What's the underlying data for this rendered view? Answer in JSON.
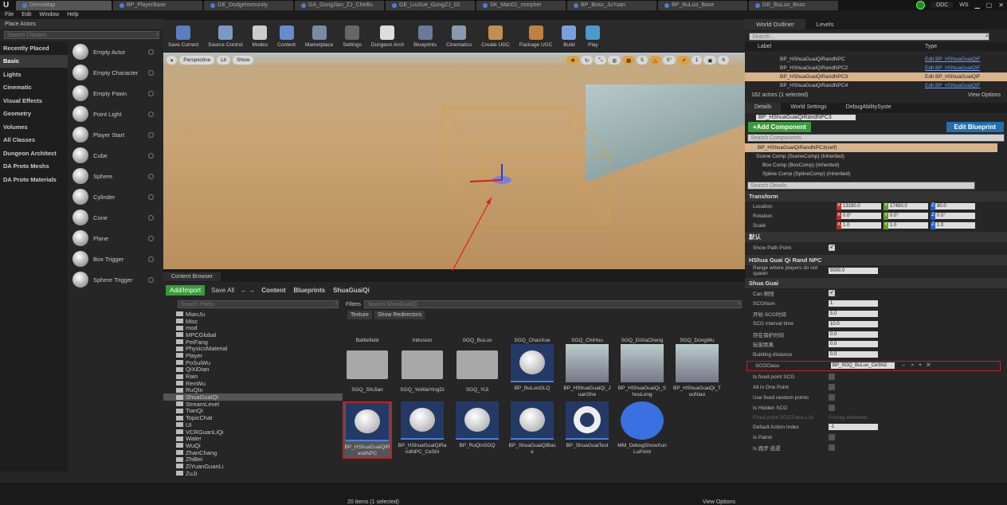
{
  "tabs": [
    "DemoMap",
    "BP_PlayerBase",
    "GE_DodgeImmunity",
    "GA_GongJian_ZJ_CheBu",
    "GE_LiuXue_GongZJ_02",
    "SK_Man01_morpher",
    "BP_Boss_JuYuan",
    "BP_BuLuo_Base",
    "GE_BuLuo_Boss"
  ],
  "titlebar": {
    "ddc": "DDC",
    "ws": "WS"
  },
  "menu": [
    "File",
    "Edit",
    "Window",
    "Help"
  ],
  "place_actors": {
    "title": "Place Actors",
    "search_placeholder": "Search Classes",
    "categories": [
      "Recently Placed",
      "Basic",
      "Lights",
      "Cinematic",
      "Visual Effects",
      "Geometry",
      "Volumes",
      "All Classes",
      "Dungeon Architect",
      "DA Proto Meshs",
      "DA Proto Materials"
    ],
    "actors": [
      "Empty Actor",
      "Empty Character",
      "Empty Pawn",
      "Point Light",
      "Player Start",
      "Cube",
      "Sphere",
      "Cylinder",
      "Cone",
      "Plane",
      "Box Trigger",
      "Sphere Trigger"
    ]
  },
  "toolbar": [
    "Save Current",
    "Source Control",
    "Modes",
    "Content",
    "Marketplace",
    "Settings",
    "Dungeon Arch",
    "Blueprints",
    "Cinematics",
    "Create UGC",
    "Package UGC",
    "Build",
    "Play"
  ],
  "viewport": {
    "perspective": "Perspective",
    "lit": "Lit",
    "show": "Show",
    "grid": "5",
    "angle": "5°",
    "scale": "1",
    "cam": "6"
  },
  "content_browser": {
    "title": "Content Browser",
    "add_import": "Add/Import",
    "save_all": "Save All",
    "breadcrumb": [
      "Content",
      "Blueprints",
      "ShuaGuaiQi"
    ],
    "search_paths": "Search Paths",
    "filters": "Filters",
    "search_placeholder": "Search ShuaGuaiQi",
    "filter_chips": [
      "Texture",
      "Show Redirectors"
    ],
    "folders": [
      "MianJu",
      "Misc",
      "mod",
      "MPCGlobal",
      "PeiFang",
      "PhysicsMaterial",
      "Player",
      "PoSuiWu",
      "QiXiDian",
      "Rain",
      "RenWu",
      "RuQIn",
      "ShuaGuaiQi",
      "StreamLevel",
      "TianQi",
      "TopicChat",
      "UI",
      "VCRGuanLiQi",
      "Water",
      "WuQi",
      "ZhanChang",
      "ZhiBei",
      "ZiYuanGuanLi",
      "ZuJi"
    ],
    "assets_row1": [
      "Battlefield",
      "Intrusion",
      "SGQ_BuLuo",
      "SGQ_ChaoXue",
      "SGQ_ChiHou",
      "SGQ_DiXiaCheng",
      "SGQ_DongWu"
    ],
    "assets_row2": [
      "SGQ_ShiJian",
      "SGQ_YeWaiYingDi",
      "SGQ_YiJi",
      "BP_BuLuoGLQ",
      "BP_HShuaGuaiQi_JuanShe",
      "BP_HShuaGuaiQi_ShouLong",
      "BP_HShuaGuaiQi_TuoNiao"
    ],
    "assets_row3": [
      "BP_HShuaGuaiQiRandNPC",
      "BP_HShuaGuaiQiRandNPC_CeShi",
      "BP_RuQinSGQ",
      "BP_ShuaGuaiQiBase",
      "BP_ShuaGuaiTest",
      "MM_DebugShowXunLuPoint"
    ],
    "status": "20 items (1 selected)",
    "view_options": "View Options"
  },
  "outliner": {
    "tabs": [
      "World Outliner",
      "Levels"
    ],
    "search_placeholder": "Search...",
    "col_label": "Label",
    "col_type": "Type",
    "rows": [
      {
        "label": "BP_HShuaGuaiQiRandNPC",
        "type": "Edit BP_HShuaGuaiQiF"
      },
      {
        "label": "BP_HShuaGuaiQiRandNPC2",
        "type": "Edit BP_HShuaGuaiQiF"
      },
      {
        "label": "BP_HShuaGuaiQiRandNPC3",
        "type": "Edit BP_HShuaGuaiQiF"
      },
      {
        "label": "BP_HShuaGuaiQiRandNPC4",
        "type": "Edit BP_HShuaGuaiQiF"
      }
    ],
    "status": "162 actors (1 selected)",
    "view_options": "View Options"
  },
  "details": {
    "tabs": [
      "Details",
      "World Settings",
      "DebugAbilitySyste"
    ],
    "name": "BP_HShuaGuaiQiRandNPC3",
    "add_component": "+Add Component",
    "edit_blueprint": "Edit Blueprint",
    "search_components": "Search Components",
    "components": [
      "BP_HShuaGuaiQiRandNPC3(self)",
      "Scene Comp (SceneComp) (Inherited)",
      "Box Comp (BoxComp) (Inherited)",
      "Spline Comp (SplineComp) (Inherited)"
    ],
    "search_details": "Search Details",
    "transform": {
      "title": "Transform",
      "location_label": "Location",
      "rotation_label": "Rotation",
      "scale_label": "Scale",
      "location": [
        "13190.0",
        "17450.0",
        "80.0"
      ],
      "rotation": [
        "0.0°",
        "0.0°",
        "0.0°"
      ],
      "scale": [
        "1.0",
        "1.0",
        "1.0"
      ]
    },
    "default_title": "默认",
    "show_path_point": "Show Path Point",
    "npc_title": "HShua Guai Qi Rand NPC",
    "range_label": "Range where players do not spawn",
    "range_value": "5000.0",
    "shua_title": "Shua Guai",
    "props": [
      {
        "label": "Can 刷怪",
        "check": true
      },
      {
        "label": "SCGNum",
        "value": "1"
      },
      {
        "label": "开始 SCG时间",
        "value": "5.0"
      },
      {
        "label": "SCG interval time",
        "value": "10.0"
      },
      {
        "label": "存在保护时间",
        "value": "0.0"
      },
      {
        "label": "玩家距离",
        "value": "0.0"
      },
      {
        "label": "Building distance",
        "value": "0.0"
      }
    ],
    "scgclass_label": "SCGClass",
    "scgclass_value": "BP_SGQ_BuLuo_CeShi2",
    "props2": [
      {
        "label": "Is fixed point SCG"
      },
      {
        "label": "All in One Point"
      },
      {
        "label": "Use fixed random points"
      },
      {
        "label": "Is Hidden SCG"
      }
    ],
    "fixed_list_label": "Fixed point SCGTrans List",
    "fixed_list_value": "0 Array elements",
    "default_action_label": "Default Action Index",
    "default_action_value": "-1",
    "is_patrol": "Is Patrol",
    "is_run": "Is 跑步 巡逻"
  }
}
